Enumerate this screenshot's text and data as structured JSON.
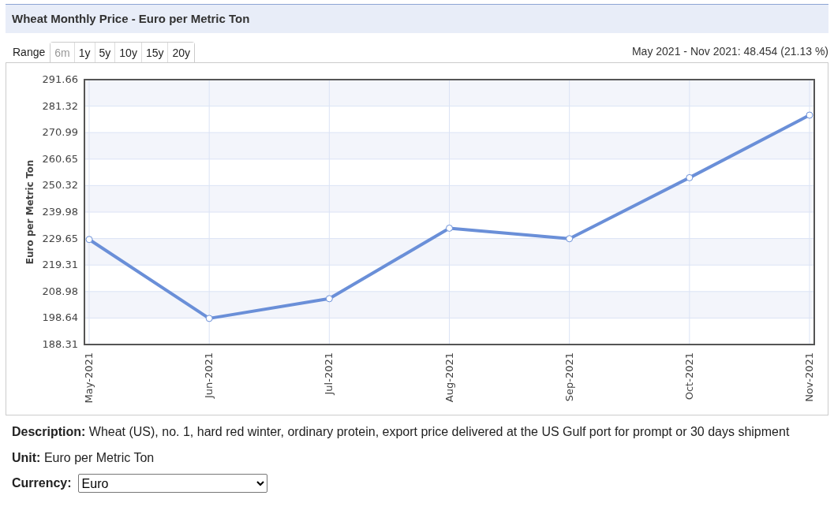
{
  "panel": {
    "title": "Wheat Monthly Price - Euro per Metric Ton"
  },
  "range": {
    "label": "Range",
    "buttons": [
      {
        "label": "6m",
        "selected": true
      },
      {
        "label": "1y",
        "selected": false
      },
      {
        "label": "5y",
        "selected": false
      },
      {
        "label": "10y",
        "selected": false
      },
      {
        "label": "15y",
        "selected": false
      },
      {
        "label": "20y",
        "selected": false
      }
    ]
  },
  "change_summary": "May 2021 - Nov 2021: 48.454 (21.13 %)",
  "chart_data": {
    "type": "line",
    "ylabel": "Euro per Metric Ton",
    "categories": [
      "May-2021",
      "Jun-2021",
      "Jul-2021",
      "Aug-2021",
      "Sep-2021",
      "Oct-2021",
      "Nov-2021"
    ],
    "grid": true,
    "series": [
      {
        "color": "#6a8fd8",
        "marker": true,
        "values": [
          229.3,
          198.5,
          206.2,
          233.7,
          229.6,
          253.4,
          277.8
        ]
      }
    ],
    "ylim": [
      188.31,
      291.66
    ],
    "yticks": [
      188.31,
      198.64,
      208.98,
      219.31,
      229.65,
      239.98,
      250.32,
      260.65,
      270.99,
      281.32,
      291.66
    ]
  },
  "description": "**Description:** Wheat (US), no. 1, hard red winter, ordinary protein, export price delivered at the US Gulf port for prompt or 30 days shipment",
  "unit": "**Unit:** Euro per Metric Ton",
  "currency": {
    "label": "Currency:",
    "value": "Euro"
  }
}
